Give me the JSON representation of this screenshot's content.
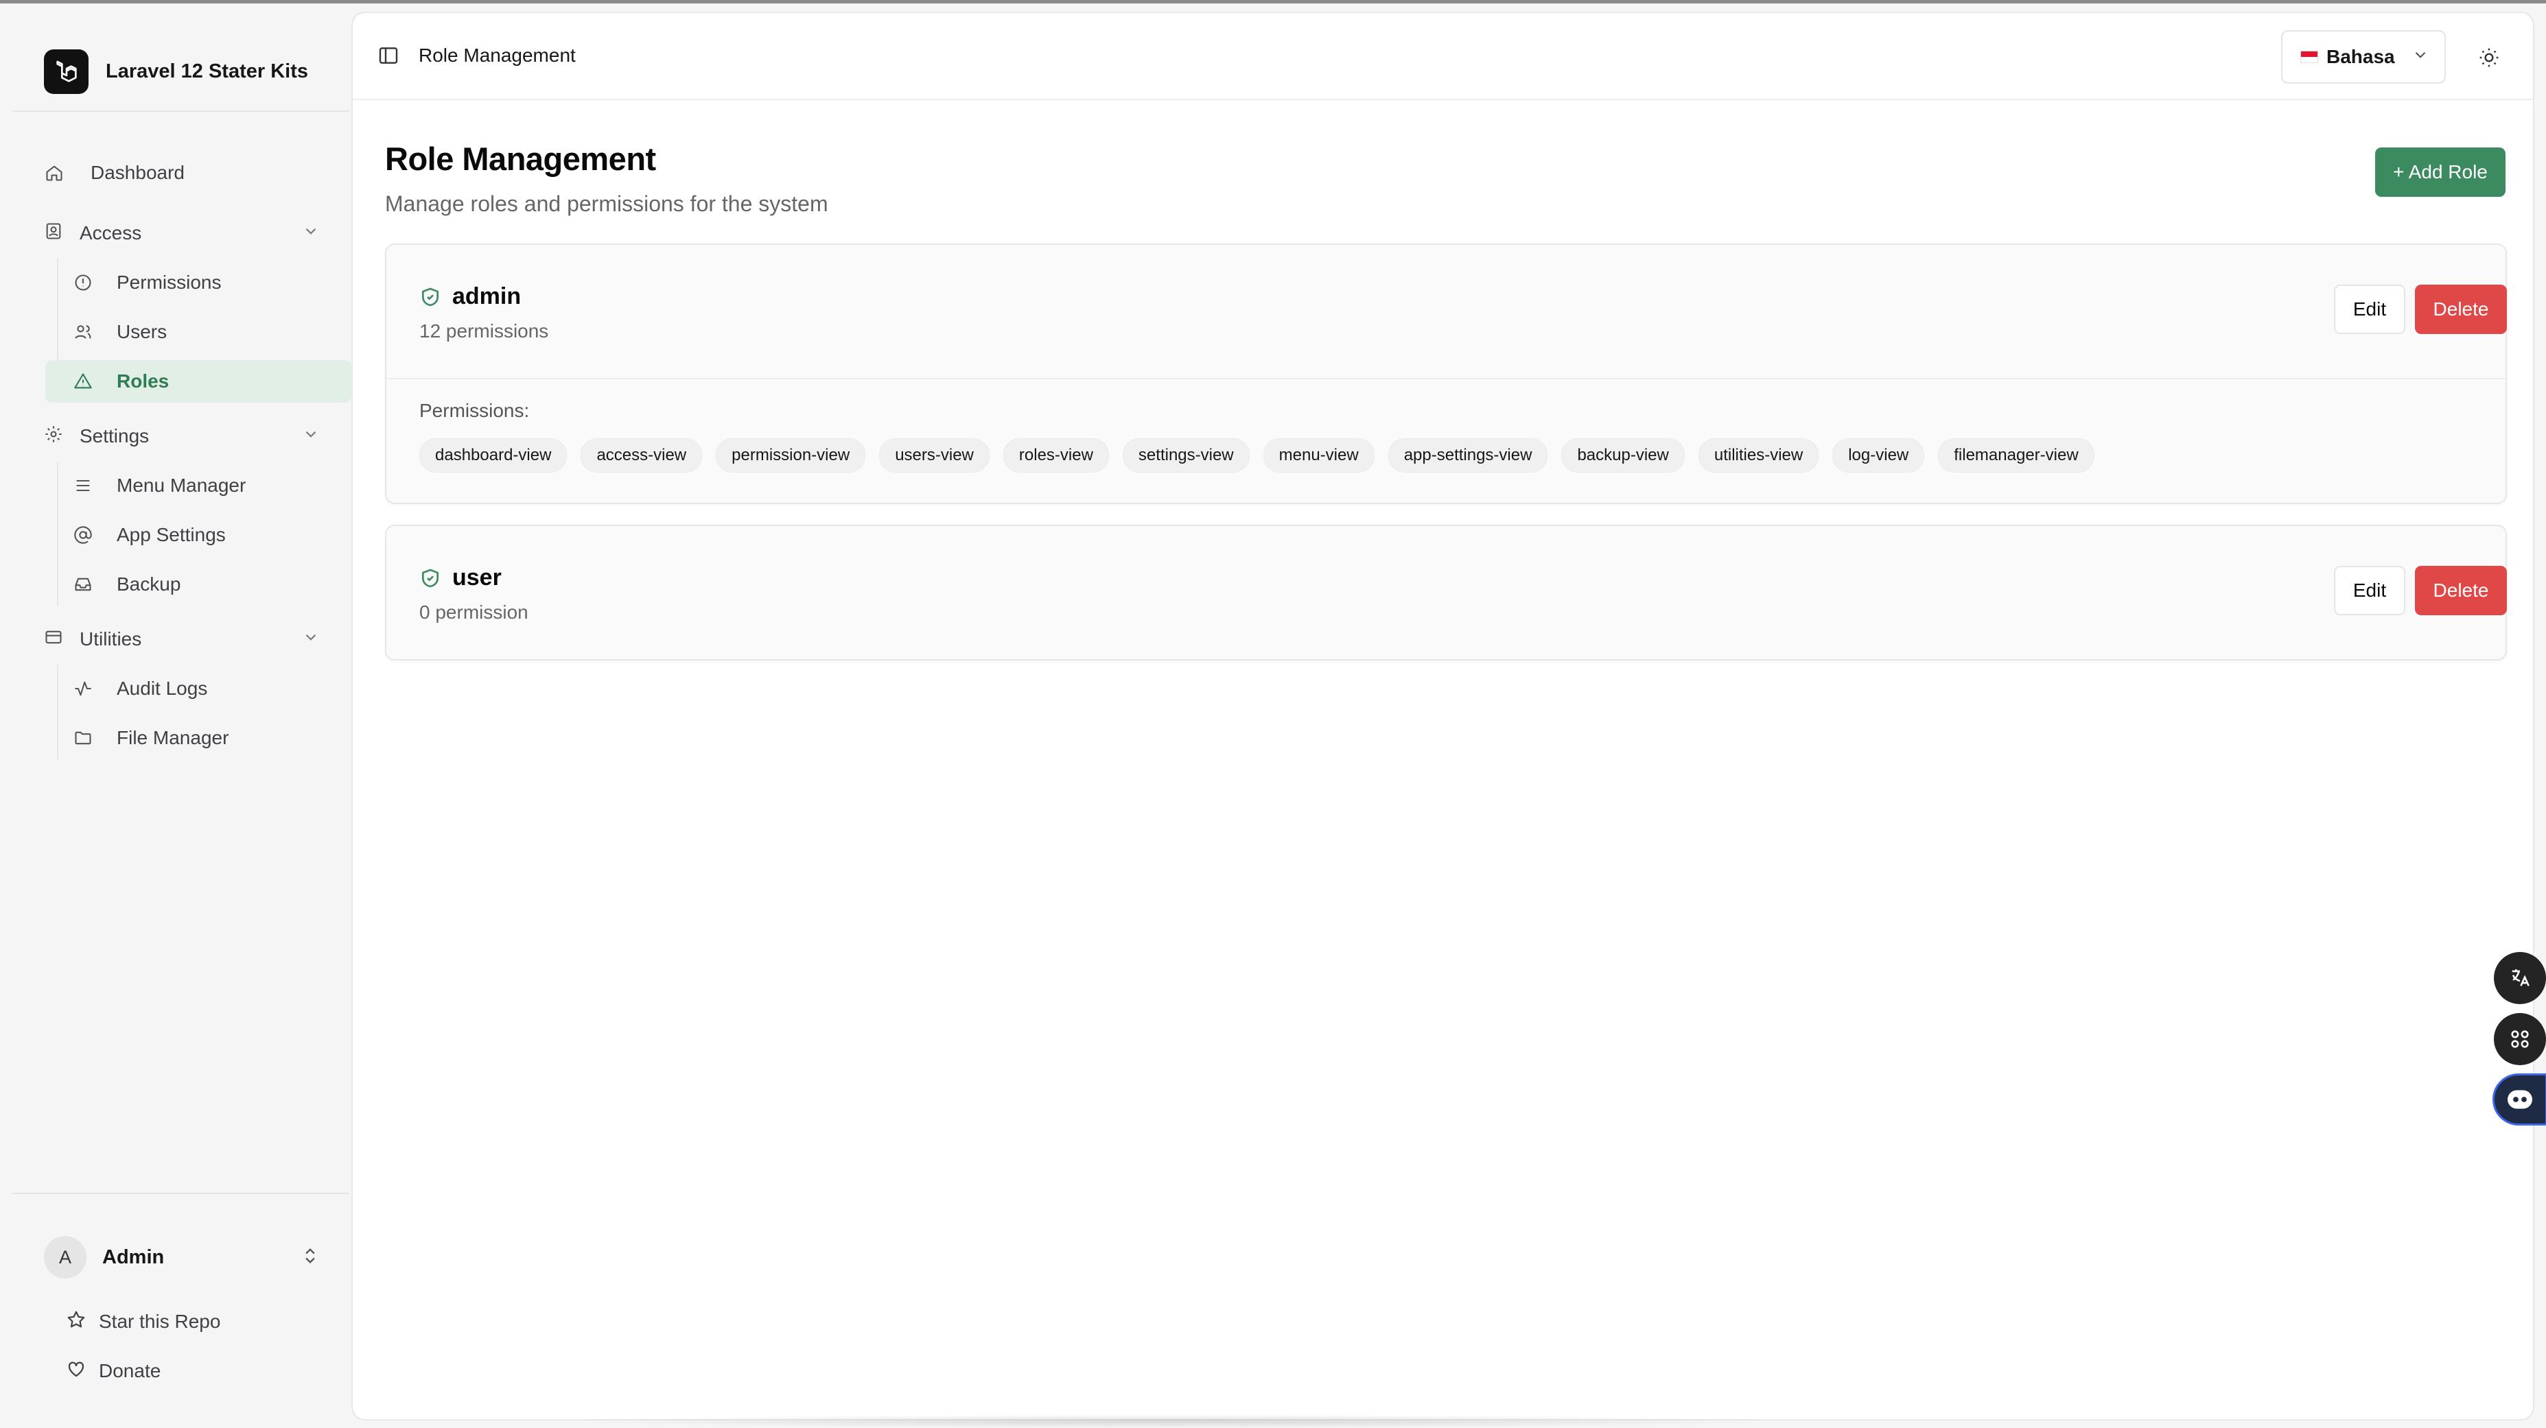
{
  "app": {
    "name": "Laravel 12 Stater Kits"
  },
  "sidebar": {
    "nav": [
      {
        "label": "Dashboard",
        "icon": "home-icon"
      }
    ],
    "groups": [
      {
        "label": "Access",
        "icon": "contact-icon",
        "items": [
          {
            "label": "Permissions",
            "icon": "alert-circle-icon"
          },
          {
            "label": "Users",
            "icon": "users-icon"
          },
          {
            "label": "Roles",
            "icon": "triangle-alert-icon",
            "active": true
          }
        ]
      },
      {
        "label": "Settings",
        "icon": "gear-icon",
        "items": [
          {
            "label": "Menu Manager",
            "icon": "menu-icon"
          },
          {
            "label": "App Settings",
            "icon": "at-sign-icon"
          },
          {
            "label": "Backup",
            "icon": "inbox-icon"
          }
        ]
      },
      {
        "label": "Utilities",
        "icon": "credit-card-icon",
        "items": [
          {
            "label": "Audit Logs",
            "icon": "activity-icon"
          },
          {
            "label": "File Manager",
            "icon": "folder-icon"
          }
        ]
      }
    ],
    "user": {
      "initial": "A",
      "name": "Admin"
    },
    "footer": [
      {
        "label": "Star this Repo",
        "icon": "star-icon"
      },
      {
        "label": "Donate",
        "icon": "heart-icon"
      }
    ]
  },
  "header": {
    "title": "Role Management",
    "language": "Bahasa"
  },
  "page": {
    "title": "Role Management",
    "subtitle": "Manage roles and permissions for the system",
    "add_button": "+ Add Role",
    "permissions_label": "Permissions:",
    "edit_label": "Edit",
    "delete_label": "Delete"
  },
  "roles": [
    {
      "name": "admin",
      "count_text": "12 permissions",
      "permissions": [
        "dashboard-view",
        "access-view",
        "permission-view",
        "users-view",
        "roles-view",
        "settings-view",
        "menu-view",
        "app-settings-view",
        "backup-view",
        "utilities-view",
        "log-view",
        "filemanager-view"
      ]
    },
    {
      "name": "user",
      "count_text": "0 permission",
      "permissions": []
    }
  ],
  "colors": {
    "accent": "#3c8b60",
    "active_bg": "#e2efe6",
    "danger": "#e04848"
  }
}
